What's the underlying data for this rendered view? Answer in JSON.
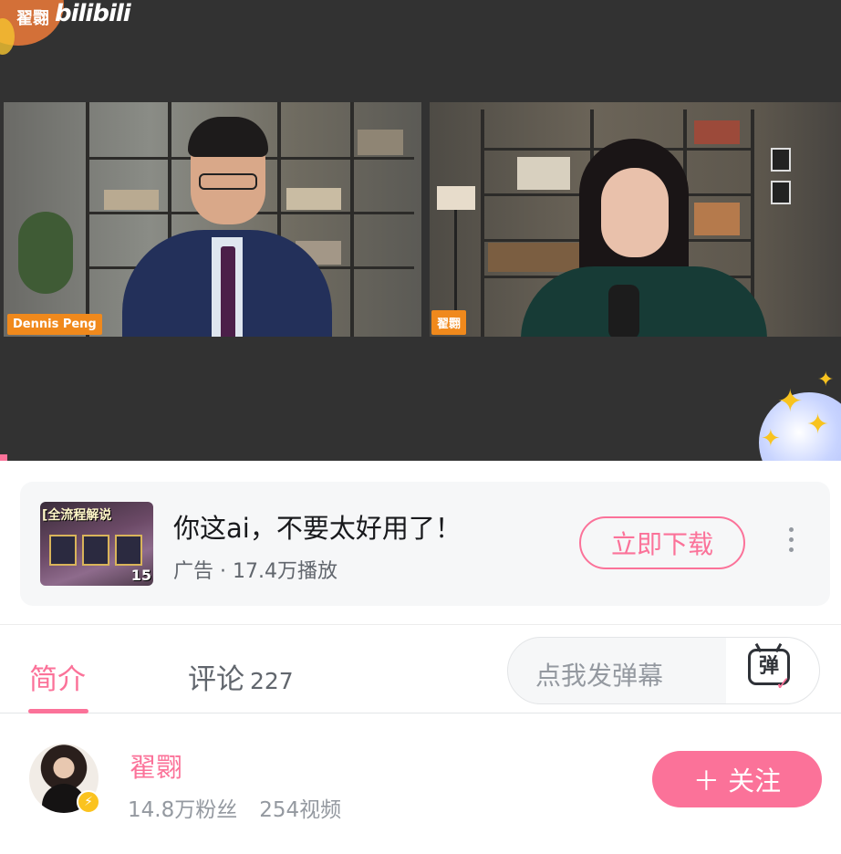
{
  "video": {
    "watermark_name": "翟翾",
    "watermark_platform": "bilibili",
    "left_speaker_tag": "Dennis Peng",
    "right_speaker_tag": "翟翾"
  },
  "ad": {
    "thumb_text": "[全流程解说",
    "thumb_number": "15",
    "title": "你这ai，不要太好用了！",
    "meta": "广告 · 17.4万播放",
    "button_label": "立即下载"
  },
  "tabs": {
    "intro_label": "简介",
    "comments_label": "评论",
    "comments_count": "227"
  },
  "danmaku": {
    "placeholder": "点我发弹幕",
    "icon_char": "弹"
  },
  "uploader": {
    "name": "翟翾",
    "followers": "14.8万粉丝",
    "videos": "254视频",
    "follow_label": "＋ 关注"
  },
  "colors": {
    "accent": "#fb7299",
    "player_bg": "#323232",
    "tag_orange": "#f0891c"
  },
  "icons": [
    "bilibili-logo",
    "more-vertical-icon",
    "danmaku-icon",
    "verified-badge-icon",
    "sparkle-icon"
  ]
}
